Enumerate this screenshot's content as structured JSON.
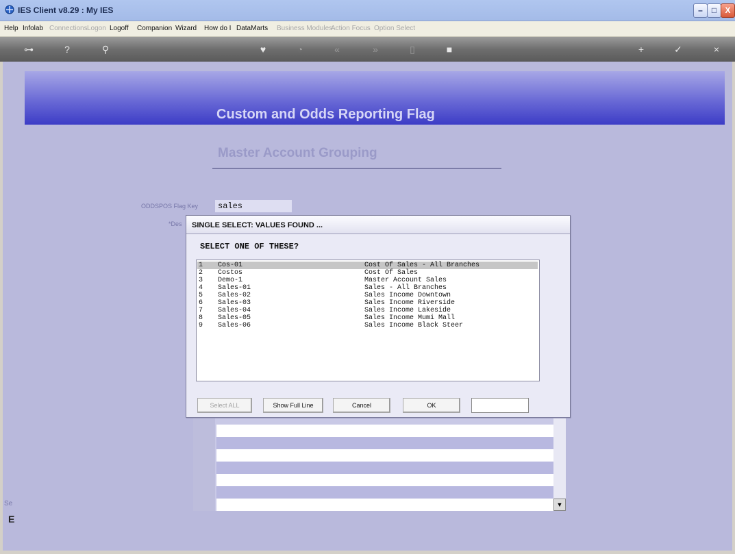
{
  "window": {
    "title": "IES Client v8.29 : My IES",
    "minimize_glyph": "–",
    "maximize_glyph": "□",
    "close_glyph": "X"
  },
  "menubar": [
    {
      "label": "Help",
      "enabled": true
    },
    {
      "label": "Infolab",
      "enabled": true
    },
    {
      "label": "Connections",
      "enabled": false
    },
    {
      "label": "Logon",
      "enabled": false
    },
    {
      "label": "Logoff",
      "enabled": true
    },
    {
      "label": "Companion",
      "enabled": true
    },
    {
      "label": "Wizard",
      "enabled": true
    },
    {
      "label": "How do I",
      "enabled": true
    },
    {
      "label": "DataMarts",
      "enabled": true
    },
    {
      "label": "Business Modules",
      "enabled": false
    },
    {
      "label": "Action Focus",
      "enabled": false
    },
    {
      "label": "Option Select",
      "enabled": false
    }
  ],
  "toolbar": {
    "icons": [
      "key-icon",
      "help-icon",
      "search-icon",
      "heart-icon",
      "clock-icon",
      "rewind-icon",
      "forward-icon",
      "placeholder-icon",
      "stop-icon",
      "plus-icon",
      "check-icon",
      "cancel-icon"
    ],
    "glyphs": [
      "⊶",
      "?",
      "⚲",
      "♥",
      "◔",
      "«",
      "»",
      "▯",
      "■",
      "+",
      "✓",
      "×"
    ]
  },
  "page": {
    "banner_title": "Custom and Odds Reporting Flag",
    "subtitle": "Master Account Grouping",
    "flag_key_label": "ODDSPOS Flag Key",
    "flag_key_value": "sales",
    "desc_label": "*Des",
    "side_text_1": "Se",
    "side_text_2": "E"
  },
  "dialog": {
    "title": "SINGLE SELECT: VALUES FOUND ...",
    "prompt": "SELECT ONE OF THESE?",
    "rows": [
      {
        "num": "1",
        "code": "Cos-01",
        "desc": "Cost Of Sales - All Branches",
        "selected": true
      },
      {
        "num": "2",
        "code": "Costos",
        "desc": "Cost Of Sales",
        "selected": false
      },
      {
        "num": "3",
        "code": "Demo-1",
        "desc": "Master Account Sales",
        "selected": false
      },
      {
        "num": "4",
        "code": "Sales-01",
        "desc": "Sales - All Branches",
        "selected": false
      },
      {
        "num": "5",
        "code": "Sales-02",
        "desc": "Sales Income Downtown",
        "selected": false
      },
      {
        "num": "6",
        "code": "Sales-03",
        "desc": "Sales Income Riverside",
        "selected": false
      },
      {
        "num": "7",
        "code": "Sales-04",
        "desc": "Sales Income Lakeside",
        "selected": false
      },
      {
        "num": "8",
        "code": "Sales-05",
        "desc": "Sales Income Mumi Mall",
        "selected": false
      },
      {
        "num": "9",
        "code": "Sales-06",
        "desc": "Sales Income Black Steer",
        "selected": false
      }
    ],
    "buttons": {
      "select_all": "Select ALL",
      "show_full_line": "Show Full Line",
      "cancel": "Cancel",
      "ok": "OK"
    },
    "search_value": ""
  },
  "grid": {
    "scroll_down_glyph": "▼"
  },
  "colors": {
    "banner_dark": "#3c3cc6",
    "background": "#b9b9dc",
    "selected_row": "#c6c6c6"
  }
}
